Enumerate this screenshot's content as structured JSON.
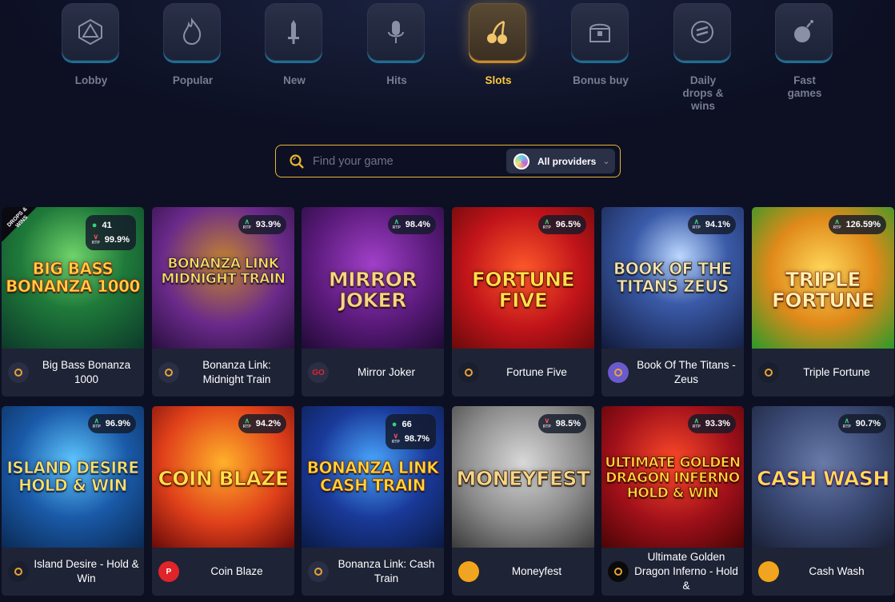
{
  "categories": [
    {
      "label": "Lobby",
      "icon": "dice-icon",
      "active": false
    },
    {
      "label": "Popular",
      "icon": "flame-icon",
      "active": false
    },
    {
      "label": "New",
      "icon": "sword-icon",
      "active": false
    },
    {
      "label": "Hits",
      "icon": "microphone-icon",
      "active": false
    },
    {
      "label": "Slots",
      "icon": "cherries-icon",
      "active": true
    },
    {
      "label": "Bonus buy",
      "icon": "treasure-chest-icon",
      "active": false
    },
    {
      "label": "Daily drops & wins",
      "icon": "drops-wins-icon",
      "active": false
    },
    {
      "label": "Fast games",
      "icon": "bomb-icon",
      "active": false
    }
  ],
  "search": {
    "placeholder": "Find your game",
    "providers_label": "All providers"
  },
  "colors": {
    "accent": "#ffc93b",
    "background": "#0d1023",
    "rtp_up": "#3ad27a",
    "rtp_down": "#ff4b5e"
  },
  "rtp_caption": "RTP",
  "drops_badge": "DROPS & WINS",
  "games": [
    {
      "name": "Big Bass Bonanza 1000",
      "art_text": "BIG BASS BONANZA 1000",
      "rtp": "99.9%",
      "rtp_dir": "down",
      "players": "41",
      "provider_icon": "pragmatic-play-icon",
      "drops": true
    },
    {
      "name": "Bonanza Link: Midnight Train",
      "art_text": "BONANZA LINK MIDNIGHT TRAIN",
      "rtp": "93.9%",
      "rtp_dir": "up",
      "provider_icon": "provider-v-icon"
    },
    {
      "name": "Mirror Joker",
      "art_text": "MIRROR JOKER",
      "rtp": "98.4%",
      "rtp_dir": "up",
      "provider_icon": "go-icon",
      "provider_text": "GO"
    },
    {
      "name": "Fortune Five",
      "art_text": "FORTUNE FIVE",
      "rtp": "96.5%",
      "rtp_dir": "up",
      "provider_icon": "gamebeat-icon"
    },
    {
      "name": "Book Of The Titans - Zeus",
      "art_text": "BOOK OF THE TITANS ZEUS",
      "rtp": "94.1%",
      "rtp_dir": "up",
      "provider_icon": "provider-s-icon"
    },
    {
      "name": "Triple Fortune",
      "art_text": "TRIPLE FORTUNE",
      "rtp": "126.59%",
      "rtp_dir": "up",
      "provider_icon": "diamond-grid-icon"
    },
    {
      "name": "Island Desire - Hold & Win",
      "art_text": "ISLAND DESIRE HOLD & WIN",
      "rtp": "96.9%",
      "rtp_dir": "up",
      "provider_icon": "provider-n-icon"
    },
    {
      "name": "Coin Blaze",
      "art_text": "COIN BLAZE",
      "rtp": "94.2%",
      "rtp_dir": "up",
      "provider_icon": "provider-p-icon",
      "provider_text": "P"
    },
    {
      "name": "Bonanza Link: Cash Train",
      "art_text": "BONANZA LINK CASH TRAIN",
      "rtp": "98.7%",
      "rtp_dir": "down",
      "players": "66",
      "provider_icon": "provider-v-icon"
    },
    {
      "name": "Moneyfest",
      "art_text": "MONEYFEST",
      "rtp": "98.5%",
      "rtp_dir": "down",
      "provider_icon": "swirl-icon"
    },
    {
      "name": "Ultimate Golden Dragon Inferno - Hold &",
      "art_text": "ULTIMATE GOLDEN DRAGON INFERNO HOLD & WIN",
      "rtp": "93.3%",
      "rtp_dir": "up",
      "provider_icon": "bs-icon"
    },
    {
      "name": "Cash Wash",
      "art_text": "CASH WASH",
      "rtp": "90.7%",
      "rtp_dir": "up",
      "provider_icon": "swirl-icon"
    }
  ]
}
